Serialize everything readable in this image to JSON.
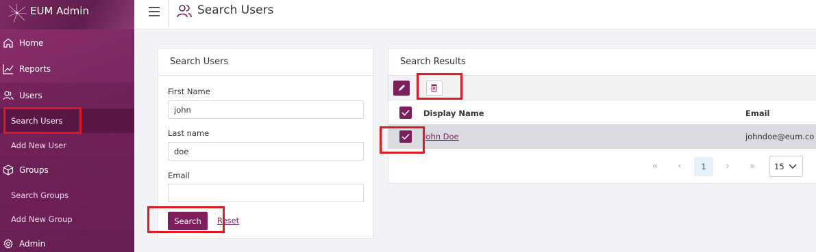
{
  "app": {
    "title": "EUM Admin"
  },
  "sidebar": {
    "items": [
      {
        "label": "Home",
        "icon": "home-icon"
      },
      {
        "label": "Reports",
        "icon": "chart-line-icon"
      },
      {
        "label": "Users",
        "icon": "users-icon"
      },
      {
        "label": "Groups",
        "icon": "cube-icon"
      },
      {
        "label": "Admin",
        "icon": "gear-icon"
      }
    ],
    "users_sub": [
      "Search Users",
      "Add New User"
    ],
    "groups_sub": [
      "Search Groups",
      "Add New Group"
    ],
    "active": "Search Users"
  },
  "topbar": {
    "menu_icon": "hamburger-icon",
    "page_icon": "users-icon",
    "page_title": "Search Users"
  },
  "search_form": {
    "title": "Search Users",
    "first_name_label": "First Name",
    "first_name_value": "john",
    "last_name_label": "Last name",
    "last_name_value": "doe",
    "email_label": "Email",
    "email_value": "",
    "search_button": "Search",
    "reset_link": "Reset"
  },
  "results": {
    "title": "Search Results",
    "toolbar": {
      "edit_icon": "pencil-icon",
      "delete_icon": "trash-icon"
    },
    "columns": [
      "Display Name",
      "Email"
    ],
    "rows": [
      {
        "display_name": "John Doe",
        "email": "johndoe@eum.co",
        "checked": true
      }
    ],
    "header_checked": true,
    "pagination": {
      "first": "«",
      "prev": "‹",
      "current": "1",
      "next": "›",
      "last": "»",
      "page_size": "15"
    }
  },
  "colors": {
    "brand": "#7c1f5c",
    "sidebar": "#8e2f6b",
    "highlight": "#e0191f"
  }
}
